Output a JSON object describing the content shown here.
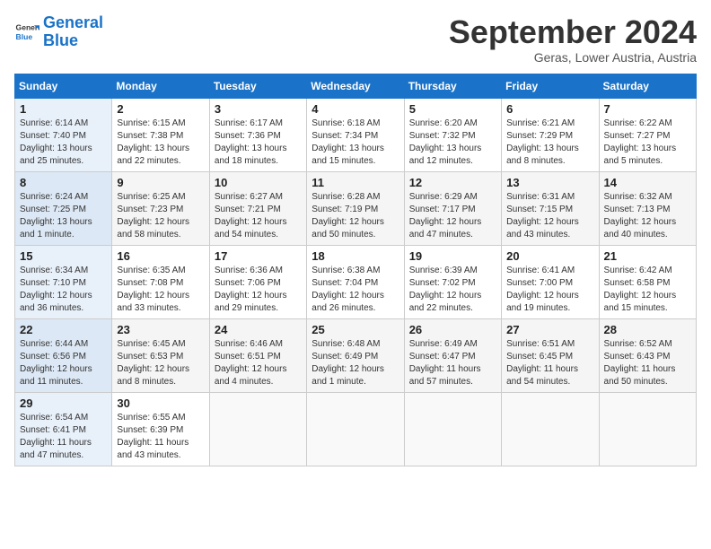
{
  "header": {
    "logo": {
      "line1": "General",
      "line2": "Blue"
    },
    "month": "September 2024",
    "location": "Geras, Lower Austria, Austria"
  },
  "weekdays": [
    "Sunday",
    "Monday",
    "Tuesday",
    "Wednesday",
    "Thursday",
    "Friday",
    "Saturday"
  ],
  "weeks": [
    [
      {
        "day": "1",
        "info": "Sunrise: 6:14 AM\nSunset: 7:40 PM\nDaylight: 13 hours\nand 25 minutes."
      },
      {
        "day": "2",
        "info": "Sunrise: 6:15 AM\nSunset: 7:38 PM\nDaylight: 13 hours\nand 22 minutes."
      },
      {
        "day": "3",
        "info": "Sunrise: 6:17 AM\nSunset: 7:36 PM\nDaylight: 13 hours\nand 18 minutes."
      },
      {
        "day": "4",
        "info": "Sunrise: 6:18 AM\nSunset: 7:34 PM\nDaylight: 13 hours\nand 15 minutes."
      },
      {
        "day": "5",
        "info": "Sunrise: 6:20 AM\nSunset: 7:32 PM\nDaylight: 13 hours\nand 12 minutes."
      },
      {
        "day": "6",
        "info": "Sunrise: 6:21 AM\nSunset: 7:29 PM\nDaylight: 13 hours\nand 8 minutes."
      },
      {
        "day": "7",
        "info": "Sunrise: 6:22 AM\nSunset: 7:27 PM\nDaylight: 13 hours\nand 5 minutes."
      }
    ],
    [
      {
        "day": "8",
        "info": "Sunrise: 6:24 AM\nSunset: 7:25 PM\nDaylight: 13 hours\nand 1 minute."
      },
      {
        "day": "9",
        "info": "Sunrise: 6:25 AM\nSunset: 7:23 PM\nDaylight: 12 hours\nand 58 minutes."
      },
      {
        "day": "10",
        "info": "Sunrise: 6:27 AM\nSunset: 7:21 PM\nDaylight: 12 hours\nand 54 minutes."
      },
      {
        "day": "11",
        "info": "Sunrise: 6:28 AM\nSunset: 7:19 PM\nDaylight: 12 hours\nand 50 minutes."
      },
      {
        "day": "12",
        "info": "Sunrise: 6:29 AM\nSunset: 7:17 PM\nDaylight: 12 hours\nand 47 minutes."
      },
      {
        "day": "13",
        "info": "Sunrise: 6:31 AM\nSunset: 7:15 PM\nDaylight: 12 hours\nand 43 minutes."
      },
      {
        "day": "14",
        "info": "Sunrise: 6:32 AM\nSunset: 7:13 PM\nDaylight: 12 hours\nand 40 minutes."
      }
    ],
    [
      {
        "day": "15",
        "info": "Sunrise: 6:34 AM\nSunset: 7:10 PM\nDaylight: 12 hours\nand 36 minutes."
      },
      {
        "day": "16",
        "info": "Sunrise: 6:35 AM\nSunset: 7:08 PM\nDaylight: 12 hours\nand 33 minutes."
      },
      {
        "day": "17",
        "info": "Sunrise: 6:36 AM\nSunset: 7:06 PM\nDaylight: 12 hours\nand 29 minutes."
      },
      {
        "day": "18",
        "info": "Sunrise: 6:38 AM\nSunset: 7:04 PM\nDaylight: 12 hours\nand 26 minutes."
      },
      {
        "day": "19",
        "info": "Sunrise: 6:39 AM\nSunset: 7:02 PM\nDaylight: 12 hours\nand 22 minutes."
      },
      {
        "day": "20",
        "info": "Sunrise: 6:41 AM\nSunset: 7:00 PM\nDaylight: 12 hours\nand 19 minutes."
      },
      {
        "day": "21",
        "info": "Sunrise: 6:42 AM\nSunset: 6:58 PM\nDaylight: 12 hours\nand 15 minutes."
      }
    ],
    [
      {
        "day": "22",
        "info": "Sunrise: 6:44 AM\nSunset: 6:56 PM\nDaylight: 12 hours\nand 11 minutes."
      },
      {
        "day": "23",
        "info": "Sunrise: 6:45 AM\nSunset: 6:53 PM\nDaylight: 12 hours\nand 8 minutes."
      },
      {
        "day": "24",
        "info": "Sunrise: 6:46 AM\nSunset: 6:51 PM\nDaylight: 12 hours\nand 4 minutes."
      },
      {
        "day": "25",
        "info": "Sunrise: 6:48 AM\nSunset: 6:49 PM\nDaylight: 12 hours\nand 1 minute."
      },
      {
        "day": "26",
        "info": "Sunrise: 6:49 AM\nSunset: 6:47 PM\nDaylight: 11 hours\nand 57 minutes."
      },
      {
        "day": "27",
        "info": "Sunrise: 6:51 AM\nSunset: 6:45 PM\nDaylight: 11 hours\nand 54 minutes."
      },
      {
        "day": "28",
        "info": "Sunrise: 6:52 AM\nSunset: 6:43 PM\nDaylight: 11 hours\nand 50 minutes."
      }
    ],
    [
      {
        "day": "29",
        "info": "Sunrise: 6:54 AM\nSunset: 6:41 PM\nDaylight: 11 hours\nand 47 minutes."
      },
      {
        "day": "30",
        "info": "Sunrise: 6:55 AM\nSunset: 6:39 PM\nDaylight: 11 hours\nand 43 minutes."
      },
      {
        "day": "",
        "info": ""
      },
      {
        "day": "",
        "info": ""
      },
      {
        "day": "",
        "info": ""
      },
      {
        "day": "",
        "info": ""
      },
      {
        "day": "",
        "info": ""
      }
    ]
  ]
}
